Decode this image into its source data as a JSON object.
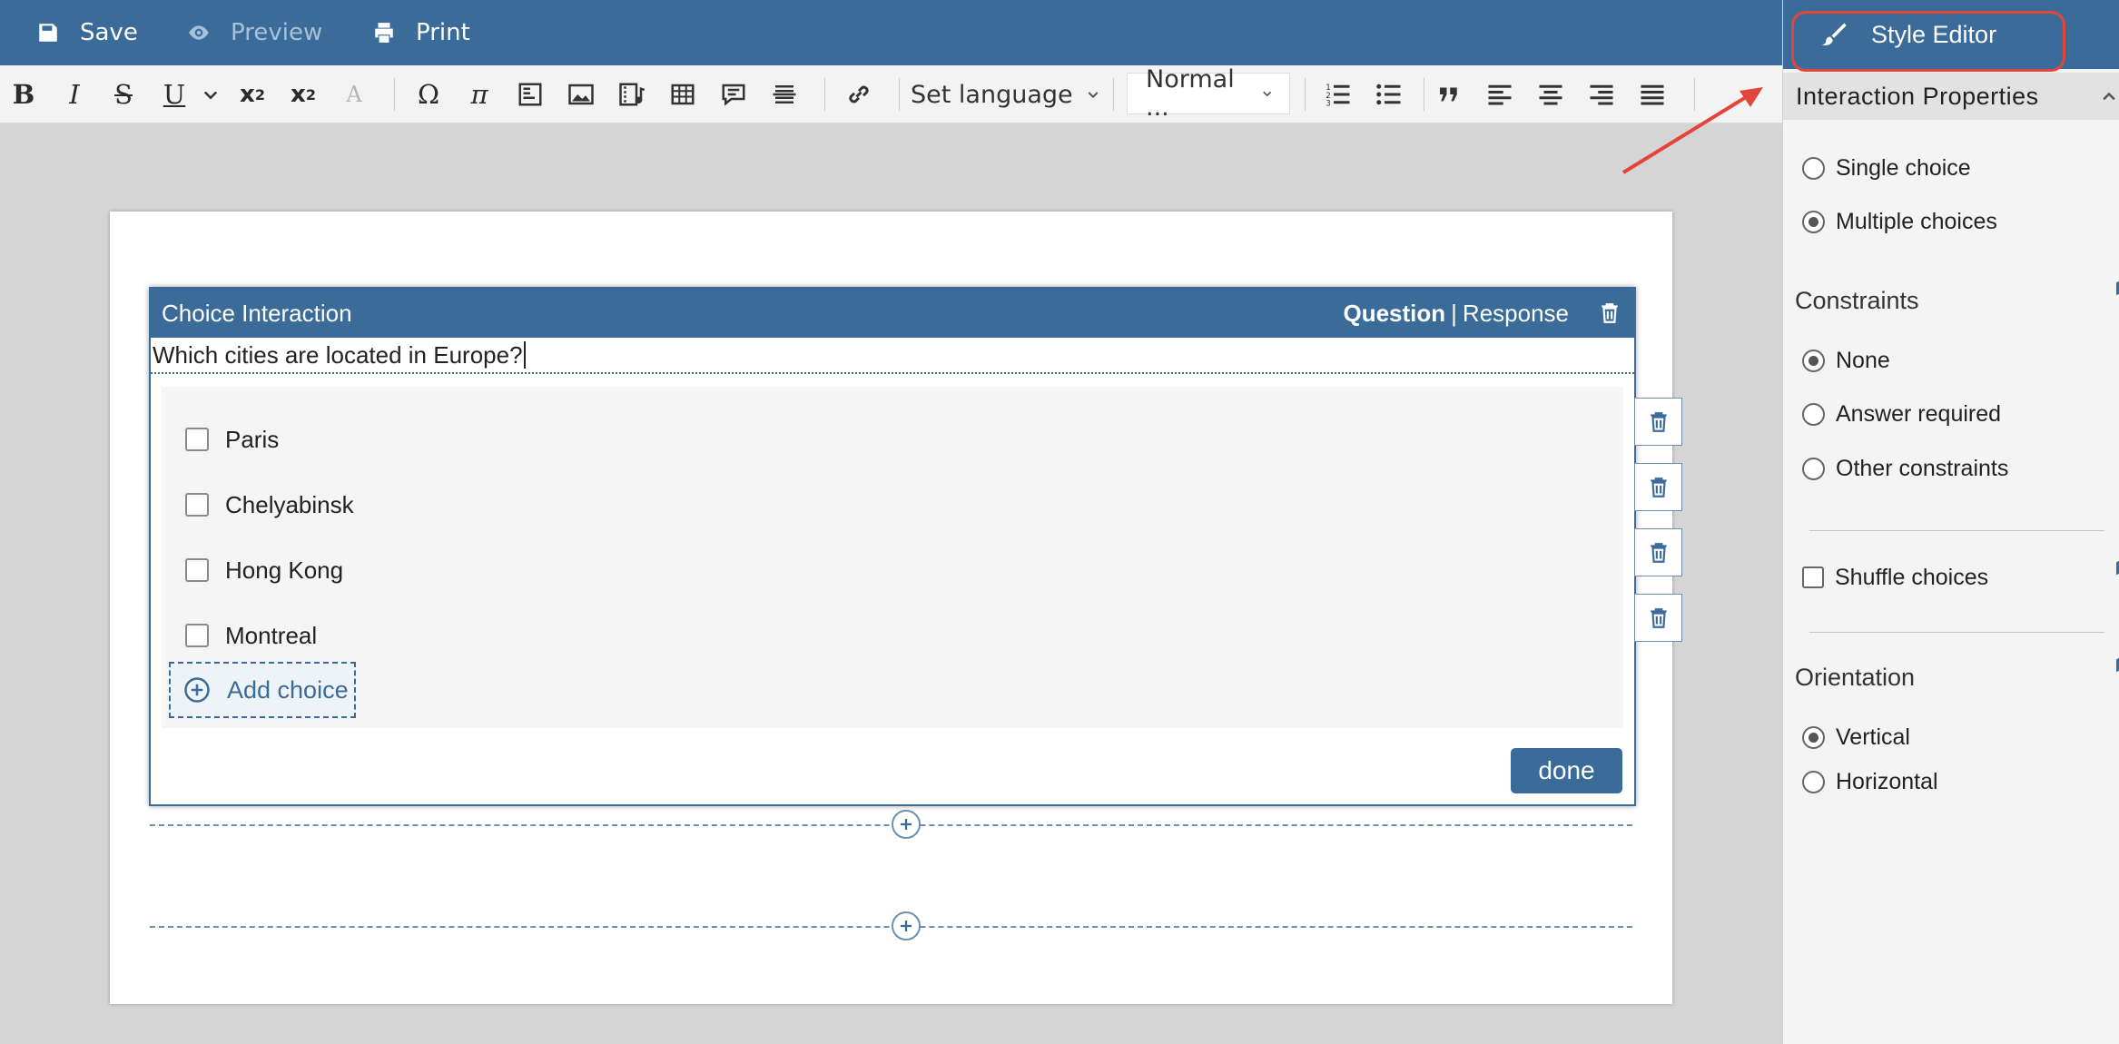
{
  "topbar": {
    "save_label": "Save",
    "preview_label": "Preview",
    "print_label": "Print"
  },
  "toolbar": {
    "language_label": "Set language",
    "format_label": "Normal ..."
  },
  "interaction": {
    "title": "Choice Interaction",
    "tab_question": "Question",
    "tab_separator": "|",
    "tab_response": "Response",
    "prompt": "Which cities are located in Europe?",
    "choices": [
      "Paris",
      "Chelyabinsk",
      "Hong Kong",
      "Montreal"
    ],
    "add_choice_label": "Add choice",
    "done_label": "done"
  },
  "sidebar": {
    "style_editor_label": "Style Editor",
    "properties_title": "Interaction Properties",
    "type_options": [
      "Single choice",
      "Multiple choices"
    ],
    "type_selected": "Multiple choices",
    "constraints_title": "Constraints",
    "constraint_options": [
      "None",
      "Answer required",
      "Other constraints"
    ],
    "constraint_selected": "None",
    "shuffle_label": "Shuffle choices",
    "shuffle_checked": false,
    "orientation_title": "Orientation",
    "orientation_options": [
      "Vertical",
      "Horizontal"
    ],
    "orientation_selected": "Vertical"
  },
  "colors": {
    "brand_blue": "#3b6b98",
    "annotation_red": "#e4453a"
  }
}
